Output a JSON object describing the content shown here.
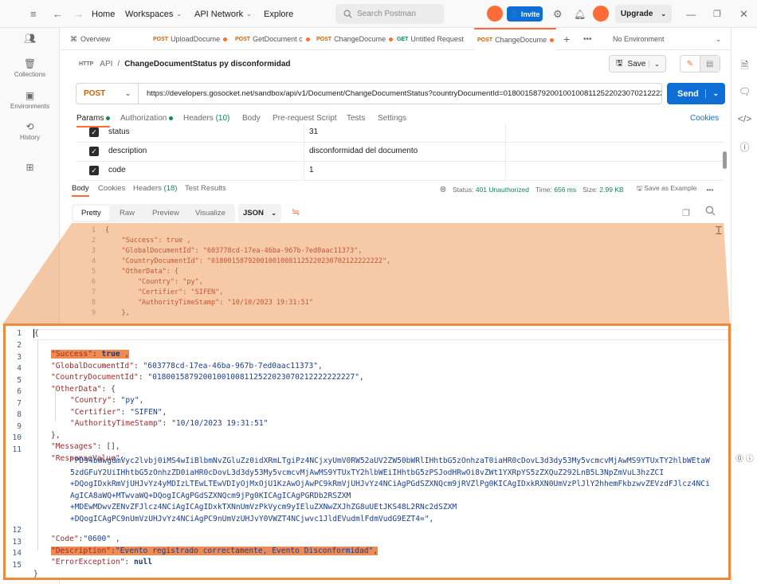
{
  "topbar": {
    "home": "Home",
    "workspaces": "Workspaces",
    "api_network": "API Network",
    "explore": "Explore",
    "search_placeholder": "Search Postman",
    "invite": "Invite",
    "upgrade": "Upgrade"
  },
  "sidebar": {
    "items": [
      {
        "label": "Collections",
        "icon": "collections-icon"
      },
      {
        "label": "Environments",
        "icon": "environments-icon"
      },
      {
        "label": "History",
        "icon": "history-icon"
      }
    ]
  },
  "tabs": [
    {
      "method": "",
      "label": "Overview",
      "dot": false
    },
    {
      "method": "POST",
      "label": "UploadDocume",
      "dot": true
    },
    {
      "method": "POST",
      "label": "GetDocument c",
      "dot": true
    },
    {
      "method": "POST",
      "label": "ChangeDocume",
      "dot": true
    },
    {
      "method": "GET",
      "label": "Untitled Request",
      "dot": false
    },
    {
      "method": "POST",
      "label": "ChangeDocume",
      "dot": true
    }
  ],
  "environment": "No Environment",
  "request": {
    "breadcrumb_root": "API",
    "breadcrumb_sep": "/",
    "name": "ChangeDocumentStatus py disconformidad",
    "save": "Save",
    "method": "POST",
    "url": "https://developers.gosocket.net/sandbox/api/v1/Document/ChangeDocumentStatus?countryDocumentId=01800158792001001008112522023070212222...",
    "send": "Send"
  },
  "request_tabs": {
    "params": "Params",
    "authorization": "Authorization",
    "headers": "Headers",
    "headers_count": "(10)",
    "body": "Body",
    "prerequest": "Pre-request Script",
    "tests": "Tests",
    "settings": "Settings",
    "cookies": "Cookies"
  },
  "params": [
    {
      "key": "status",
      "value": "31"
    },
    {
      "key": "description",
      "value": "disconformidad del documento"
    },
    {
      "key": "code",
      "value": "1"
    }
  ],
  "response": {
    "tabs": {
      "body": "Body",
      "cookies": "Cookies",
      "headers": "Headers",
      "headers_count": "(18)",
      "test_results": "Test Results"
    },
    "status_label": "Status:",
    "status": "401 Unauthorized",
    "time_label": "Time:",
    "time": "656 ms",
    "size_label": "Size:",
    "size": "2.99 KB",
    "save_example": "Save as Example",
    "views": {
      "pretty": "Pretty",
      "raw": "Raw",
      "preview": "Preview",
      "visualize": "Visualize"
    },
    "format": "JSON"
  },
  "small_editor_lines": [
    {
      "n": "1",
      "t": "{"
    },
    {
      "n": "2",
      "t": "    \"Success\": true ,"
    },
    {
      "n": "3",
      "t": "    \"GlobalDocumentId\": \"603778cd-17ea-46ba-967b-7ed0aac11373\","
    },
    {
      "n": "4",
      "t": "    \"CountryDocumentId\": \"018001587920010010081125220230702122222222\","
    },
    {
      "n": "5",
      "t": "    \"OtherData\": {"
    },
    {
      "n": "6",
      "t": "        \"Country\": \"py\","
    },
    {
      "n": "7",
      "t": "        \"Certifier\": \"SIFEN\","
    },
    {
      "n": "8",
      "t": "        \"AuthorityTimeStamp\": \"10/10/2023 19:31:51\""
    },
    {
      "n": "9",
      "t": "    },"
    }
  ],
  "json": {
    "l1": "{",
    "success_key": "\"Success\"",
    "success_val": "true",
    "global_key": "\"GlobalDocumentId\"",
    "global_val": "\"603778cd-17ea-46ba-967b-7ed0aac11373\"",
    "country_doc_key": "\"CountryDocumentId\"",
    "country_doc_val": "\"01800158792001001008112522023070212222222227\"",
    "other_key": "\"OtherData\"",
    "country_key": "\"Country\"",
    "country_val": "\"py\"",
    "certifier_key": "\"Certifier\"",
    "certifier_val": "\"SIFEN\"",
    "ats_key": "\"AuthorityTimeStamp\"",
    "ats_val": "\"10/10/2023 19:31:51\"",
    "messages_key": "\"Messages\"",
    "messages_val": "[]",
    "response_key": "\"ResponseValue\"",
    "response_lines": [
      "\"PD94bWwgdmVyc2lvbj0iMS4wIiBlbmNvZGluZz0idXRmLTgiPz4NCjxyUmV0RW52aUV2ZW50bWRlIHhtbG5zOnhzaT0iaHR0cDovL3d3dy53My5vcmcvMjAwMS9YTUxTY2hlbWEtaW",
      "5zdGFuY2UiIHhtbG5zOnhzZD0iaHR0cDovL3d3dy53My5vcmcvMjAwMS9YTUxTY2hlbWEiIHhtbG5zPSJodHRwOi8vZWt1YXRpYS5zZXQuZ292LnB5L3NpZmVuL3hzZCI",
      "+DQogIDxkRmVjUHJvYz4yMDIzLTEwLTEwVDIyOjMxOjU1KzAwOjAwPC9kRmVjUHJvYz4NCiAgPGdSZXNQcm9jRVZlPg0KICAgIDxkRXN0UmVzPlJlY2hhemFkbzwvZEVzdFJlcz4NCi",
      "AgICA8aWQ+MTwvaWQ+DQogICAgPGdSZXNQcm9jPg0KICAgICAgPGRDb2RSZXM",
      "+MDEwMDwvZENvZFJlcz4NCiAgICAgIDxkTXNnUmVzPkVycm9yIEluZXNwZXJhZG8uUEtJKS48L2RNc2dSZXM",
      "+DQogICAgPC9nUmVzUHJvYz4NCiAgPC9nUmVzUHJvY0VWZT4NCjwvc1JldEVudmlFdmVudG9EZT4=\","
    ],
    "code_key": "\"Code\"",
    "code_val": "\"0600\"",
    "description_key": "\"Description\"",
    "description_val": "\"Evento registrado correctamente, Evento Disconformidad\"",
    "error_key": "\"ErrorException\"",
    "error_val": "null",
    "last": "}",
    "line_numbers": [
      "1",
      "2",
      "3",
      "4",
      "5",
      "6",
      "7",
      "8",
      "9",
      "10",
      "11",
      "12",
      "13",
      "14",
      "15"
    ]
  },
  "colors": {
    "accent": "#ff6c37",
    "send_blue": "#0f6ed6",
    "highlight": "#ef8a52",
    "callout_border": "#ee8a3c",
    "status_green": "#10875d"
  }
}
